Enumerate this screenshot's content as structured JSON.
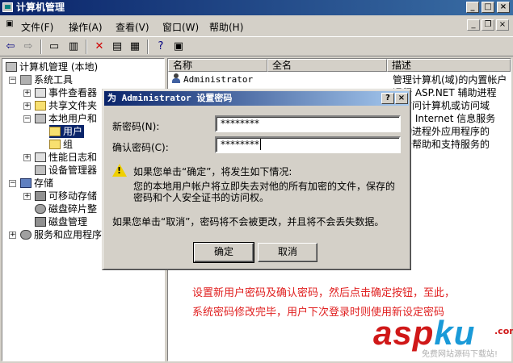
{
  "window": {
    "title": "计算机管理"
  },
  "menu": {
    "items": [
      "文件(F)",
      "操作(A)",
      "查看(V)",
      "窗口(W)",
      "帮助(H)"
    ]
  },
  "tree": {
    "items": [
      {
        "label": "计算机管理 (本地)",
        "icon": "computer-icon"
      },
      {
        "label": "系统工具",
        "icon": "tools-icon"
      },
      {
        "label": "事件查看器",
        "icon": "event-viewer-icon"
      },
      {
        "label": "共享文件夹",
        "icon": "folder-icon"
      },
      {
        "label": "本地用户和",
        "icon": "users-icon"
      },
      {
        "label": "用户",
        "icon": "folder-icon"
      },
      {
        "label": "组",
        "icon": "folder-icon"
      },
      {
        "label": "性能日志和",
        "icon": "log-icon"
      },
      {
        "label": "设备管理器",
        "icon": "device-icon"
      },
      {
        "label": "存储",
        "icon": "storage-icon"
      },
      {
        "label": "可移动存储",
        "icon": "removable-icon"
      },
      {
        "label": "磁盘碎片整",
        "icon": "defrag-icon"
      },
      {
        "label": "磁盘管理",
        "icon": "disk-icon"
      },
      {
        "label": "服务和应用程序",
        "icon": "services-icon"
      }
    ]
  },
  "list": {
    "columns": [
      "名称",
      "全名",
      "描述"
    ],
    "rows": [
      {
        "name": "Administrator",
        "fullname": "",
        "desc": "管理计算机(域)的内置帐户"
      },
      {
        "name": "",
        "fullname": "",
        "desc": "运行 ASP.NET 辅助进程"
      },
      {
        "name": "",
        "fullname": "",
        "desc": "宾访问计算机或访问域"
      },
      {
        "name": "",
        "fullname": "",
        "desc": "访问 Internet 信息服务"
      },
      {
        "name": "",
        "fullname": "",
        "desc": "启动进程外应用程序的"
      },
      {
        "name": "",
        "fullname": "",
        "desc": "一个帮助和支持服务的"
      }
    ]
  },
  "dialog": {
    "title": "为 Administrator 设置密码",
    "help_btn": "?",
    "close_btn": "×",
    "new_password_label": "新密码(N):",
    "new_password_value": "********",
    "confirm_password_label": "确认密码(C):",
    "confirm_password_value": "********",
    "warning_line1": "如果您单击“确定”，将发生如下情况:",
    "warning_line2": "您的本地用户帐户将立即失去对他的所有加密的文件，保存的",
    "warning_line3": "密码和个人安全证书的访问权。",
    "cancel_note": "如果您单击“取消”，密码将不会被更改，并且将不会丢失数据。",
    "ok_label": "确定",
    "cancel_label": "取消"
  },
  "annotation": {
    "line1": "设置新用户密码及确认密码，然后点击确定按钮，至此，",
    "line2": "系统密码修改完毕，用户下次登录时则使用新设定密码",
    "color": "#e02020"
  },
  "watermark": {
    "part_a": "asp",
    "part_b": "ku",
    "suffix": ".com",
    "tagline": "免费网站源码下载站!"
  }
}
